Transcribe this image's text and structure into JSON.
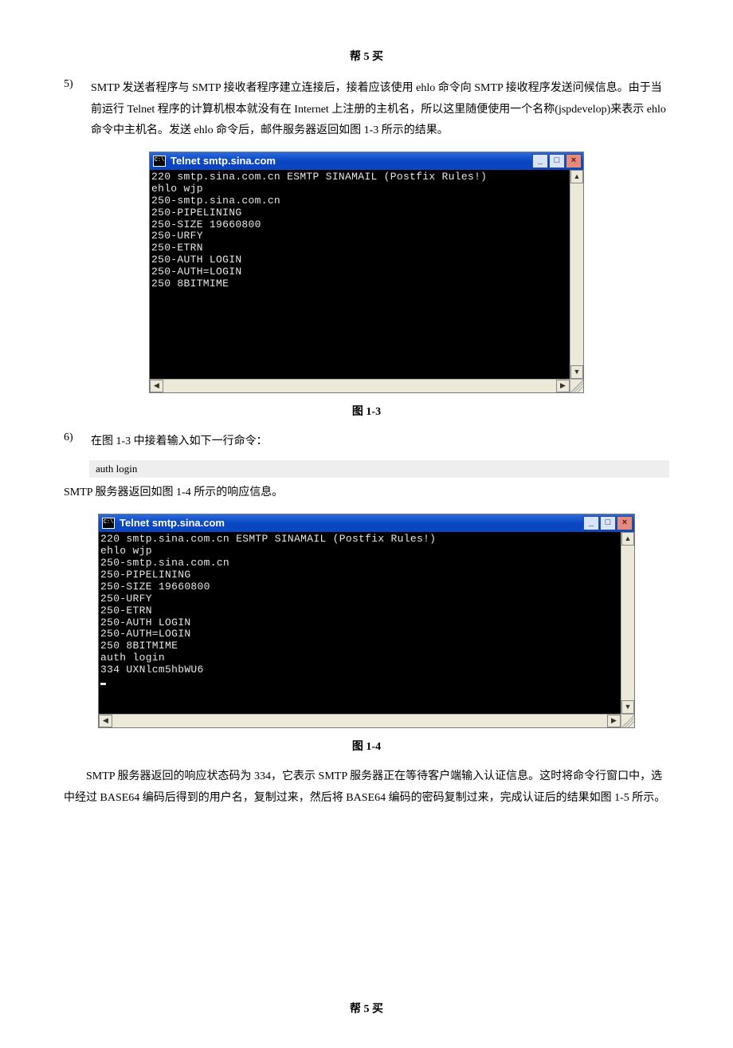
{
  "page": {
    "header": "帮 5 买",
    "footer": "帮 5 买"
  },
  "item5": {
    "number": "5)",
    "text": "SMTP 发送者程序与 SMTP 接收者程序建立连接后，接着应该使用 ehlo 命令向 SMTP 接收程序发送问候信息。由于当前运行 Telnet 程序的计算机根本就没有在 Internet 上注册的主机名，所以这里随便使用一个名称(jspdevelop)来表示 ehlo 命令中主机名。发送 ehlo 命令后，邮件服务器返回如图 1-3 所示的结果。"
  },
  "terminal1": {
    "title": "Telnet smtp.sina.com",
    "lines": [
      "220 smtp.sina.com.cn ESMTP SINAMAIL (Postfix Rules!)",
      "ehlo wjp",
      "250-smtp.sina.com.cn",
      "250-PIPELINING",
      "250-SIZE 19660800",
      "250-URFY",
      "250-ETRN",
      "250-AUTH LOGIN",
      "250-AUTH=LOGIN",
      "250 8BITMIME"
    ]
  },
  "fig1_caption": "图 1-3",
  "item6": {
    "number": "6)",
    "text": "在图 1-3 中接着输入如下一行命令："
  },
  "code1": "auth login",
  "after_code1": "SMTP 服务器返回如图 1-4 所示的响应信息。",
  "terminal2": {
    "title": "Telnet smtp.sina.com",
    "lines": [
      "220 smtp.sina.com.cn ESMTP SINAMAIL (Postfix Rules!)",
      "ehlo wjp",
      "250-smtp.sina.com.cn",
      "250-PIPELINING",
      "250-SIZE 19660800",
      "250-URFY",
      "250-ETRN",
      "250-AUTH LOGIN",
      "250-AUTH=LOGIN",
      "250 8BITMIME",
      "auth login",
      "334 UXNlcm5hbWU6"
    ]
  },
  "fig2_caption": "图 1-4",
  "para_after": "　　SMTP 服务器返回的响应状态码为 334，它表示 SMTP 服务器正在等待客户端输入认证信息。这时将命令行窗口中，选中经过 BASE64 编码后得到的用户名，复制过来，然后将 BASE64 编码的密码复制过来，完成认证后的结果如图 1-5 所示。",
  "winbuttons": {
    "min": "_",
    "max": "□",
    "close": "×"
  },
  "scroll": {
    "up": "▲",
    "down": "▼",
    "left": "◀",
    "right": "▶"
  },
  "icon_text": "C:\\"
}
